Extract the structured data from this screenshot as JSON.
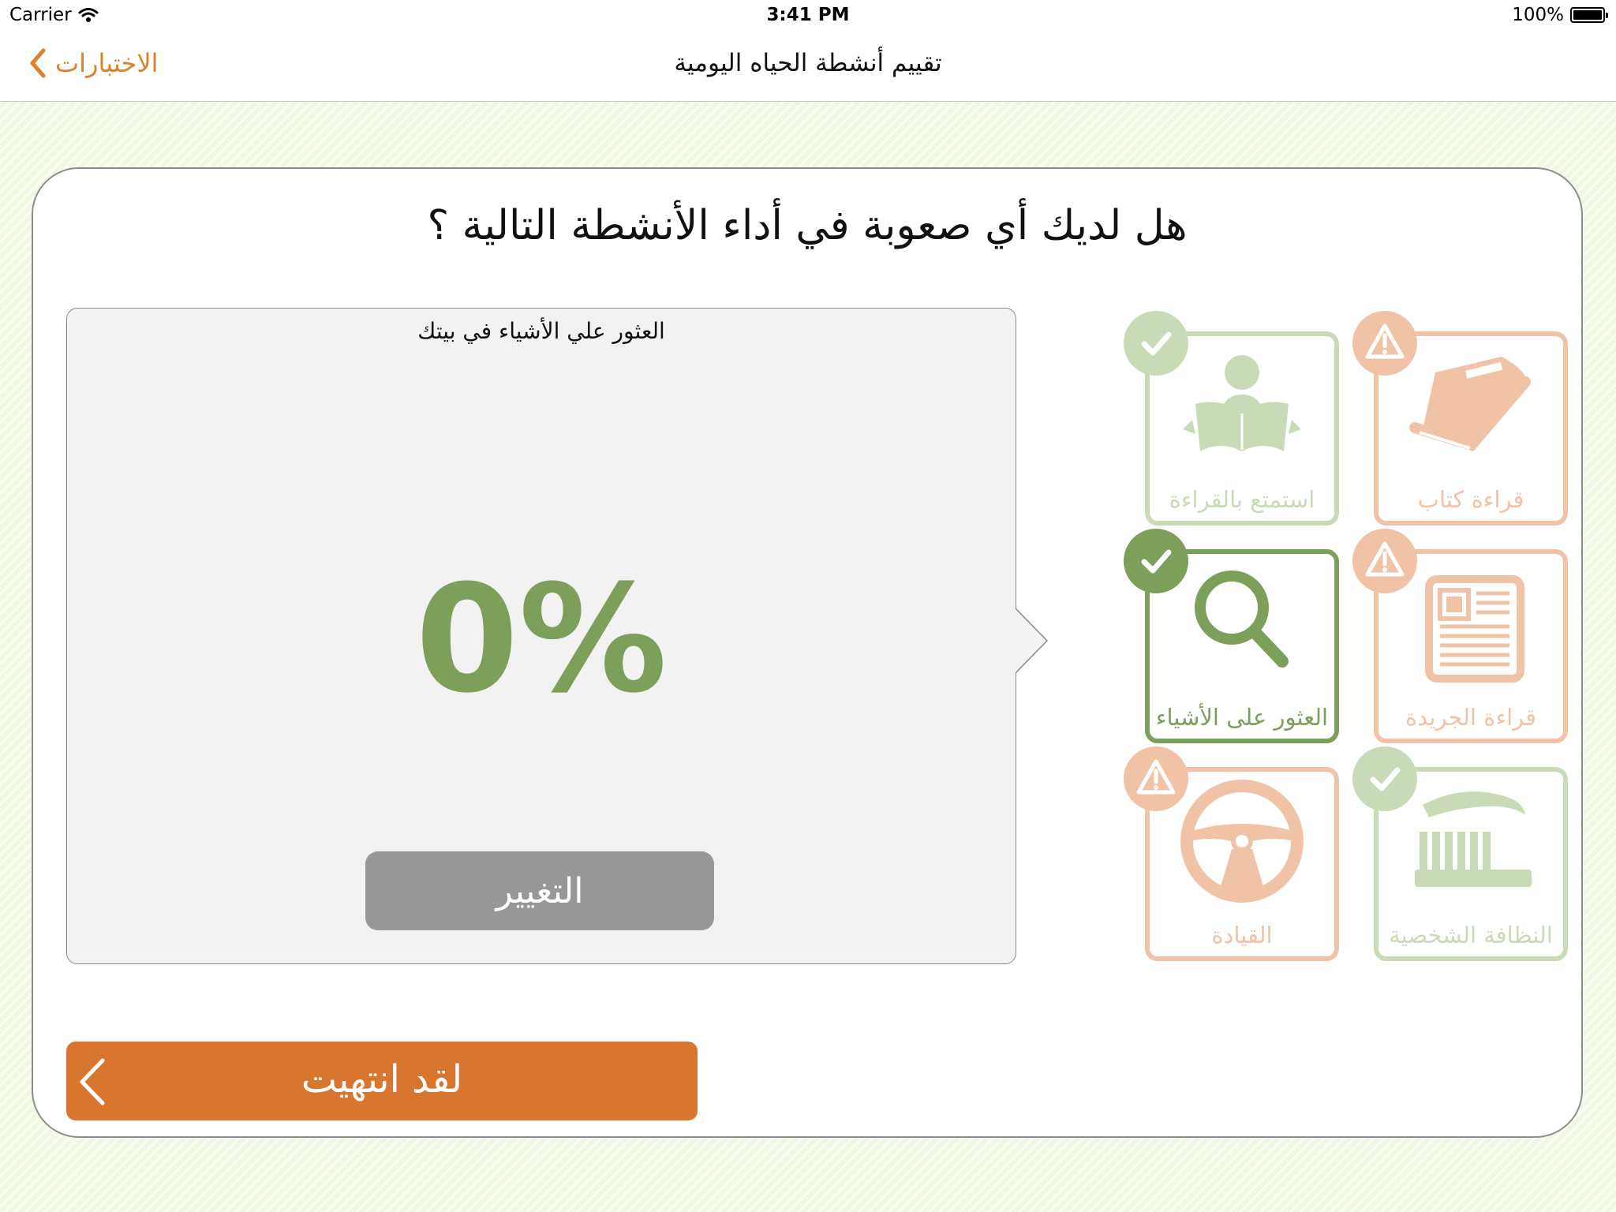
{
  "status_bar": {
    "carrier": "Carrier",
    "time": "3:41 PM",
    "battery": "100%"
  },
  "nav": {
    "back_label": "الاختبارات",
    "title": "تقييم أنشطة الحياه اليومية"
  },
  "question": "هل لديك أي صعوبة في أداء الأنشطة التالية ؟",
  "detail": {
    "title": "العثور علي الأشياء في بيتك",
    "value": "0%",
    "change_label": "التغيير"
  },
  "done_label": "لقد انتهيت",
  "colors": {
    "accent_orange": "#d87630",
    "green": "#7c9f5a",
    "green_faded": "#c9dab7",
    "orange_faded": "#f0c3a6",
    "gray_button": "#979797"
  },
  "activities": [
    {
      "label": "استمتع بالقراءة",
      "icon": "reading-person-icon",
      "status": "ok",
      "selected": false
    },
    {
      "label": "قراءة كتاب",
      "icon": "book-icon",
      "status": "warning",
      "selected": false
    },
    {
      "label": "العثور على الأشياء",
      "icon": "magnifier-icon",
      "status": "ok",
      "selected": true
    },
    {
      "label": "قراءة الجريدة",
      "icon": "newspaper-icon",
      "status": "warning",
      "selected": false
    },
    {
      "label": "القيادة",
      "icon": "steering-wheel-icon",
      "status": "warning",
      "selected": false
    },
    {
      "label": "النظافة الشخصية",
      "icon": "toothbrush-icon",
      "status": "ok",
      "selected": false
    }
  ]
}
